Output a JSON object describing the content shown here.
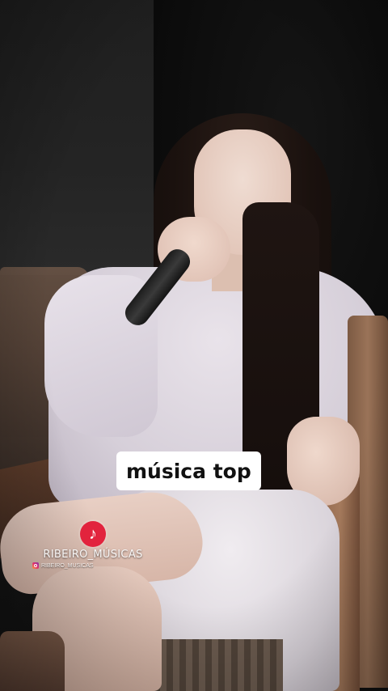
{
  "video": {
    "caption": "música top",
    "watermark": {
      "logo_icon": "music-note-icon",
      "logo_glyph": "♪",
      "logo_color": "#e2233d",
      "channel_name": "RIBEIRO_MÚSICAS",
      "handle_icon": "instagram-icon",
      "handle": "RIBEIRO_MUSICAS"
    }
  }
}
